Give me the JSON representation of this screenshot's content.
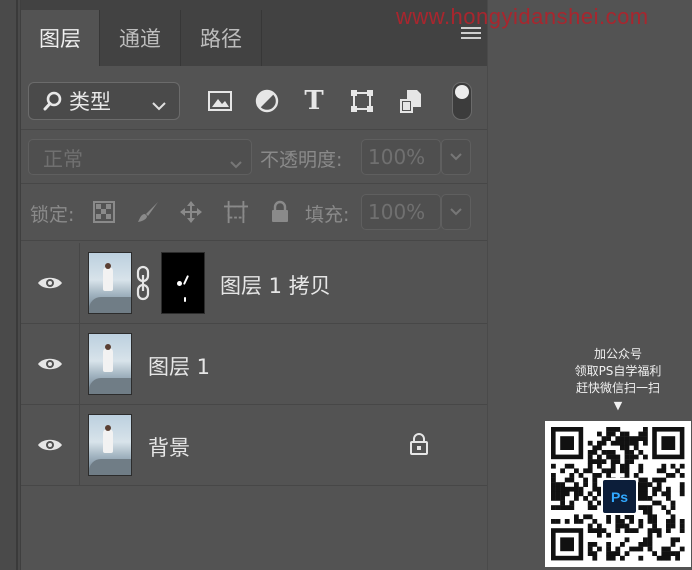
{
  "watermark": "www.hongyidanshei.com",
  "tabs": [
    {
      "label": "图层",
      "active": true
    },
    {
      "label": "通道",
      "active": false
    },
    {
      "label": "路径",
      "active": false
    }
  ],
  "panel_menu_icon": "hamburger-menu-icon",
  "filter": {
    "kind_label": "类型",
    "icons": [
      "image-filter-icon",
      "adjustment-filter-icon",
      "type-filter-icon",
      "shape-filter-icon",
      "smart-object-filter-icon"
    ],
    "type_glyph": "T"
  },
  "blend": {
    "mode": "正常",
    "opacity_label": "不透明度:",
    "opacity_value": "100%"
  },
  "lock": {
    "label": "锁定:",
    "icons": [
      "lock-transparent-pixels-icon",
      "lock-image-pixels-icon",
      "lock-position-icon",
      "lock-artboard-icon",
      "lock-all-icon"
    ],
    "fill_label": "填充:",
    "fill_value": "100%"
  },
  "layers": [
    {
      "name": "图层 1 拷贝",
      "visible": true,
      "has_mask": true,
      "locked": false
    },
    {
      "name": "图层 1",
      "visible": true,
      "has_mask": false,
      "locked": false
    },
    {
      "name": "背景",
      "visible": true,
      "has_mask": false,
      "locked": true
    }
  ],
  "promo": {
    "line1": "加公众号",
    "line2": "领取PS自学福利",
    "line3": "赶快微信扫一扫",
    "arrow": "▼",
    "logo_text": "Ps"
  }
}
